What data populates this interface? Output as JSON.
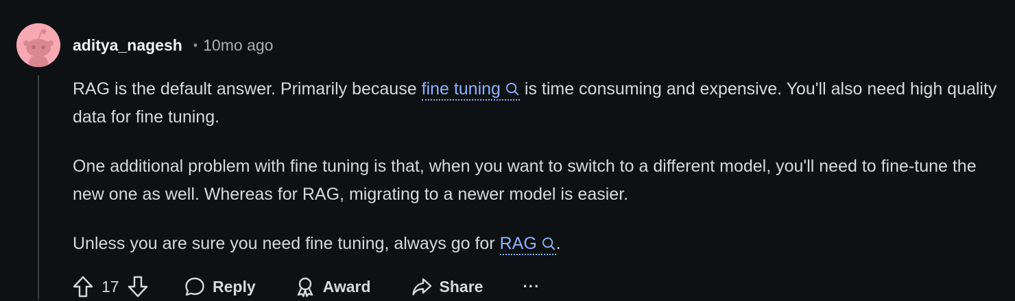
{
  "comment": {
    "username": "aditya_nagesh",
    "separator": "•",
    "timestamp": "10mo ago",
    "avatar_color": "#f7a9b3",
    "link_color": "#8db3ff",
    "paragraphs": [
      {
        "before": "RAG is the default answer. Primarily because ",
        "link": "fine tuning",
        "after": " is time consuming and expensive. You'll also need high quality data for fine tuning."
      },
      {
        "text": "One additional problem with fine tuning is that, when you want to switch to a different model, you'll need to fine-tune the new one as well. Whereas for RAG, migrating to a newer model is easier."
      },
      {
        "before": "Unless you are sure you need fine tuning, always go for ",
        "link": "RAG",
        "after": "."
      }
    ]
  },
  "actions": {
    "vote_count": "17",
    "reply_label": "Reply",
    "award_label": "Award",
    "share_label": "Share",
    "more_label": "···",
    "icons": [
      "upvote-icon",
      "downvote-icon",
      "reply-icon",
      "award-icon",
      "share-icon",
      "more-icon"
    ]
  }
}
